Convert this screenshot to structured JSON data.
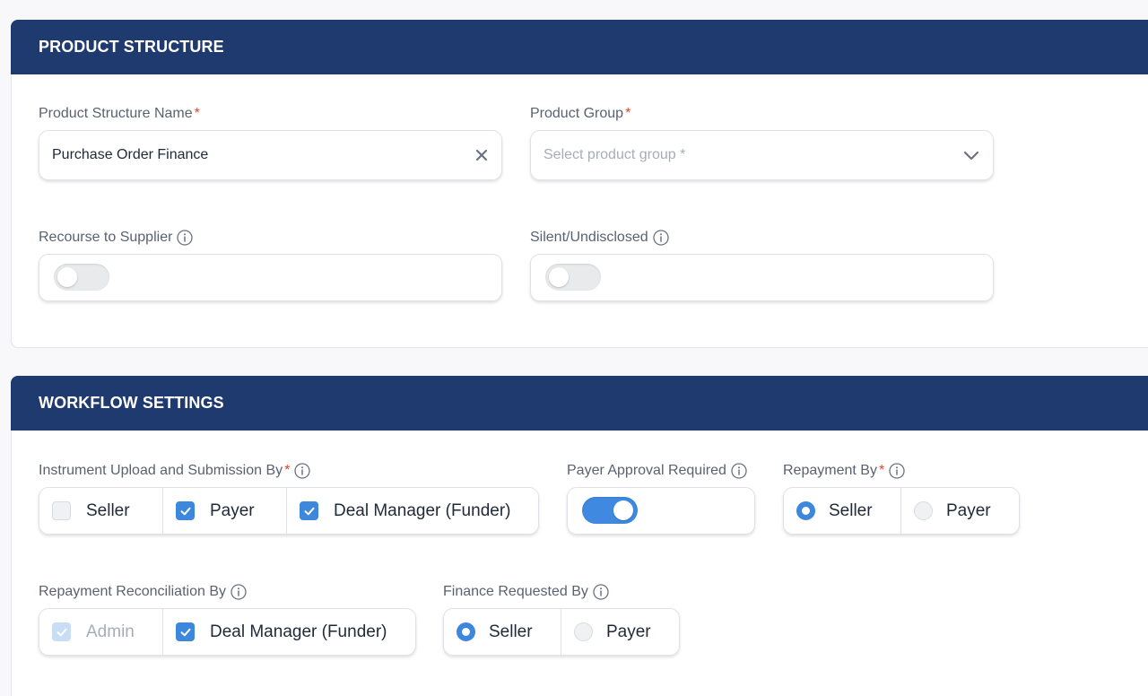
{
  "product_structure": {
    "title": "PRODUCT STRUCTURE",
    "name_field": {
      "label": "Product Structure Name",
      "required_mark": "*",
      "value": "Purchase Order Finance"
    },
    "group_field": {
      "label": "Product Group",
      "required_mark": "*",
      "placeholder": "Select product group *"
    },
    "recourse": {
      "label": "Recourse to Supplier",
      "enabled": false
    },
    "silent": {
      "label": "Silent/Undisclosed",
      "enabled": false
    }
  },
  "workflow_settings": {
    "title": "WORKFLOW SETTINGS",
    "instrument_upload": {
      "label": "Instrument Upload and Submission By",
      "required_mark": "*",
      "options": [
        {
          "label": "Seller",
          "checked": false
        },
        {
          "label": "Payer",
          "checked": true
        },
        {
          "label": "Deal Manager (Funder)",
          "checked": true
        }
      ]
    },
    "payer_approval": {
      "label": "Payer Approval Required",
      "enabled": true
    },
    "repayment_by": {
      "label": "Repayment By",
      "required_mark": "*",
      "options": [
        {
          "label": "Seller",
          "selected": true
        },
        {
          "label": "Payer",
          "selected": false
        }
      ]
    },
    "repayment_reconciliation": {
      "label": "Repayment Reconciliation By",
      "options": [
        {
          "label": "Admin",
          "checked": true,
          "disabled": true
        },
        {
          "label": "Deal Manager (Funder)",
          "checked": true
        }
      ]
    },
    "finance_requested": {
      "label": "Finance Requested By",
      "options": [
        {
          "label": "Seller",
          "selected": true
        },
        {
          "label": "Payer",
          "selected": false
        }
      ]
    }
  },
  "colors": {
    "header_bg": "#1f3a6e",
    "accent": "#3d87dd",
    "required": "#e0452b"
  }
}
